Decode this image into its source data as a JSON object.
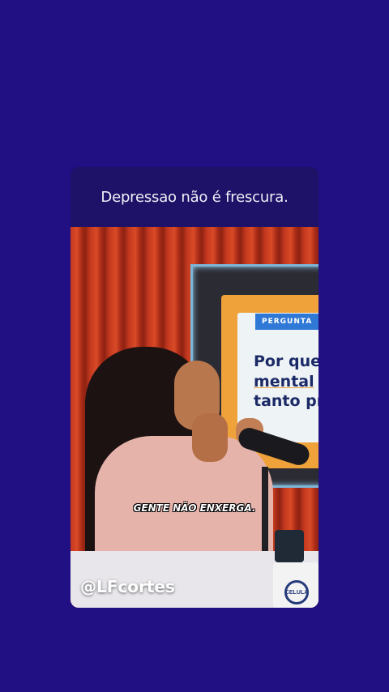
{
  "post": {
    "caption": "Depressao não é frescura.",
    "video": {
      "board_tag": "PERGUNTA",
      "board_lines": [
        "Por que",
        "mental",
        "tanto pr"
      ],
      "subtitle": "GENTE NÃO ENXERGA.",
      "watermark": "@LFcortes",
      "cup_logo": "CELULA"
    }
  },
  "colors": {
    "background": "#211083",
    "header": "#1d1268",
    "curtain": "#c3381f",
    "board": "#f0a23a",
    "tag": "#2f78d6"
  }
}
